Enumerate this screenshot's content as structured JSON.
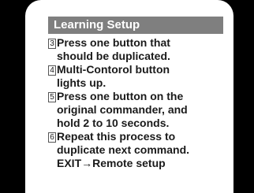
{
  "title": "Learning Setup",
  "steps": [
    {
      "number": "3",
      "lines": [
        "Press one button that",
        "should be duplicated."
      ]
    },
    {
      "number": "4",
      "lines": [
        "Multi-Contorol  button",
        "lights up."
      ]
    },
    {
      "number": "5",
      "lines": [
        "Press one button on the",
        "original commander, and",
        "hold 2 to 10 seconds."
      ]
    },
    {
      "number": "6",
      "lines": [
        "Repeat this process to",
        "duplicate next command."
      ]
    }
  ],
  "exit": {
    "key": "EXIT",
    "arrow": "→",
    "target": "Remote setup"
  }
}
